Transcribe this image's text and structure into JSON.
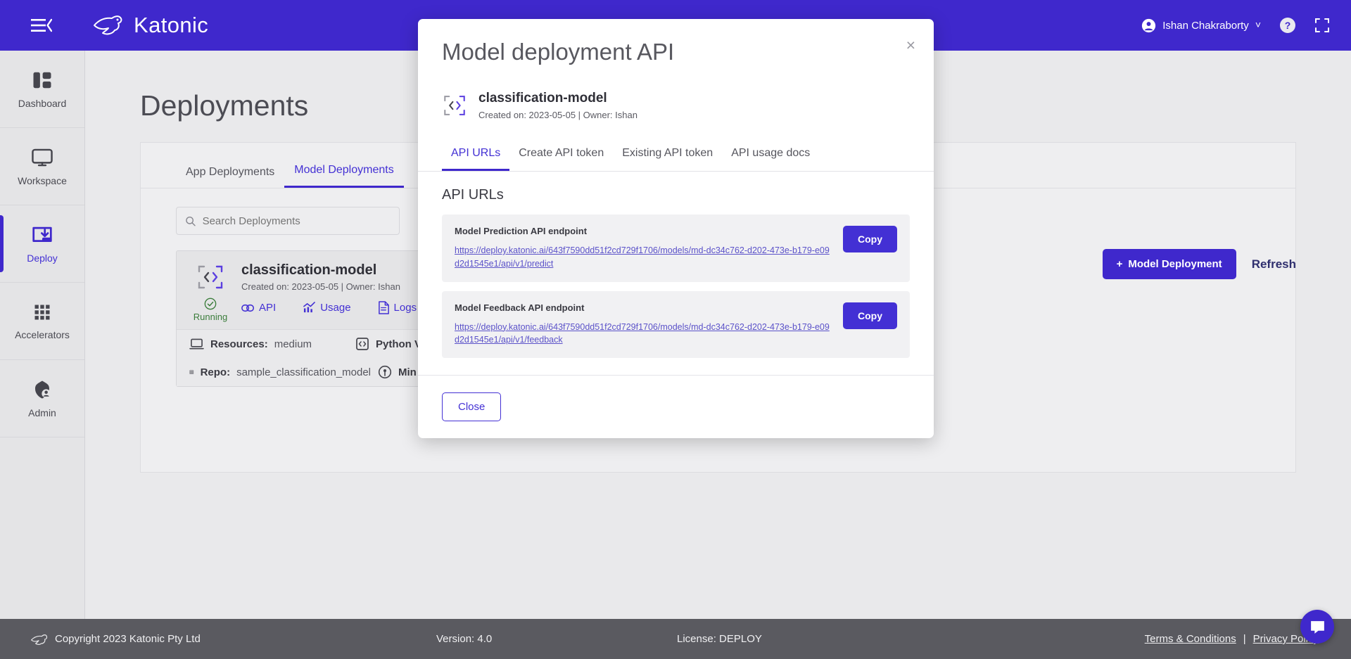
{
  "topbar": {
    "menu_icon": "menu-collapse-icon",
    "brand": "Katonic",
    "user_name": "Ishan Chakraborty",
    "help_icon": "help-icon",
    "fullscreen_icon": "fullscreen-icon"
  },
  "sidebar": {
    "items": [
      {
        "label": "Dashboard",
        "icon": "dashboard-icon",
        "active": false
      },
      {
        "label": "Workspace",
        "icon": "monitor-icon",
        "active": false
      },
      {
        "label": "Deploy",
        "icon": "deploy-icon",
        "active": true
      },
      {
        "label": "Accelerators",
        "icon": "grid-icon",
        "active": false
      },
      {
        "label": "Admin",
        "icon": "admin-user-icon",
        "active": false
      }
    ]
  },
  "page": {
    "title": "Deployments",
    "tabs": [
      {
        "label": "App Deployments",
        "active": false
      },
      {
        "label": "Model Deployments",
        "active": true
      }
    ],
    "search_placeholder": "Search Deployments",
    "search_value": "",
    "new_deployment_button": "Model Deployment",
    "new_deployment_plus": "+",
    "refresh_link": "Refresh",
    "card": {
      "name": "classification-model",
      "meta": "Created on: 2023-05-05 | Owner: Ishan",
      "status": "Running",
      "actions": [
        {
          "label": "API",
          "icon": "link-icon"
        },
        {
          "label": "Usage",
          "icon": "chart-icon"
        },
        {
          "label": "Logs",
          "icon": "document-icon"
        }
      ],
      "rows": [
        [
          {
            "icon": "laptop-icon",
            "label": "Resources:",
            "value": "medium"
          },
          {
            "icon": "code-brackets-icon",
            "label": "Python Ver",
            "value": ""
          }
        ],
        [
          {
            "icon": "server-icon",
            "label": "Repo:",
            "value": "sample_classification_model"
          },
          {
            "icon": "pods-icon",
            "label": "Min Pods :",
            "value": ""
          }
        ]
      ]
    }
  },
  "modal": {
    "title": "Model deployment API",
    "close_x": "×",
    "model_icon": "code-brackets-icon",
    "model_name": "classification-model",
    "model_meta": "Created on: 2023-05-05 | Owner: Ishan",
    "tabs": [
      {
        "label": "API URLs",
        "active": true
      },
      {
        "label": "Create API token",
        "active": false
      },
      {
        "label": "Existing API token",
        "active": false
      },
      {
        "label": "API usage docs",
        "active": false
      }
    ],
    "section_heading": "API URLs",
    "endpoints": [
      {
        "label": "Model Prediction API endpoint",
        "url": "https://deploy.katonic.ai/643f7590dd51f2cd729f1706/models/md-dc34c762-d202-473e-b179-e09d2d1545e1/api/v1/predict",
        "copy_label": "Copy"
      },
      {
        "label": "Model Feedback API endpoint",
        "url": "https://deploy.katonic.ai/643f7590dd51f2cd729f1706/models/md-dc34c762-d202-473e-b179-e09d2d1545e1/api/v1/feedback",
        "copy_label": "Copy"
      }
    ],
    "close_button": "Close"
  },
  "footer": {
    "copyright": "Copyright 2023 Katonic Pty Ltd",
    "version": "Version: 4.0",
    "license": "License: DEPLOY",
    "terms": "Terms & Conditions",
    "separator": "|",
    "privacy": "Privacy Policy"
  },
  "colors": {
    "brand_purple": "#3f28cc",
    "link_purple": "#4330d4",
    "status_green": "#3b7d3b",
    "footer_gray": "#5a5a60"
  }
}
